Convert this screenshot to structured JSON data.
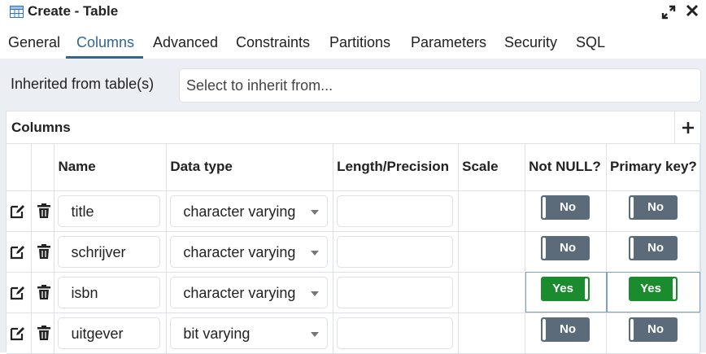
{
  "window": {
    "title": "Create - Table"
  },
  "tabs": [
    {
      "label": "General"
    },
    {
      "label": "Columns",
      "active": true
    },
    {
      "label": "Advanced"
    },
    {
      "label": "Constraints"
    },
    {
      "label": "Partitions"
    },
    {
      "label": "Parameters"
    },
    {
      "label": "Security"
    },
    {
      "label": "SQL"
    }
  ],
  "inherit": {
    "label": "Inherited from table(s)",
    "placeholder": "Select to inherit from..."
  },
  "columns_panel": {
    "title": "Columns",
    "headers": {
      "name": "Name",
      "data_type": "Data type",
      "length": "Length/Precision",
      "scale": "Scale",
      "not_null": "Not NULL?",
      "primary_key": "Primary key?"
    },
    "rows": [
      {
        "name": "title",
        "data_type": "character varying",
        "length": "",
        "scale": "",
        "not_null": "No",
        "primary_key": "No"
      },
      {
        "name": "schrijver",
        "data_type": "character varying",
        "length": "",
        "scale": "",
        "not_null": "No",
        "primary_key": "No"
      },
      {
        "name": "isbn",
        "data_type": "character varying",
        "length": "",
        "scale": "",
        "not_null": "Yes",
        "primary_key": "Yes"
      },
      {
        "name": "uitgever",
        "data_type": "bit varying",
        "length": "",
        "scale": "",
        "not_null": "No",
        "primary_key": "No"
      }
    ]
  },
  "colors": {
    "accent": "#326690",
    "toggle_on": "#1b8c2e",
    "toggle_off": "#5b6b79"
  },
  "icons": [
    "table-icon",
    "maximize-icon",
    "close-icon",
    "plus-icon",
    "edit-icon",
    "trash-icon",
    "dropdown-caret-icon"
  ]
}
